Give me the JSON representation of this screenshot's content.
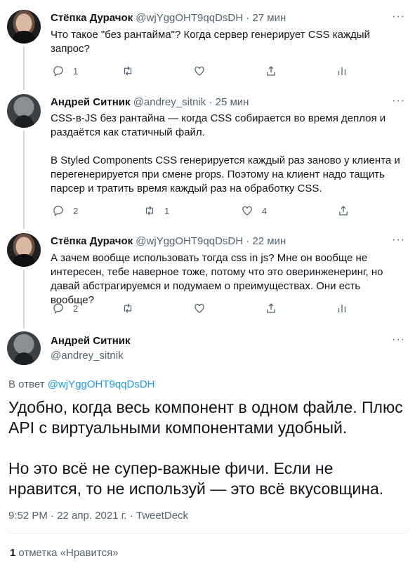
{
  "tweets": [
    {
      "name": "Стёпка Дурачок",
      "meta": "@wjYggOHT9qqDsDH · 27 мин",
      "paragraphs": [
        "Что такое \"без рантайма\"? Когда сервер генерирует CSS каждый запрос?"
      ],
      "reply_count": "1",
      "retweet_count": "",
      "like_count": ""
    },
    {
      "name": "Андрей Ситник",
      "meta": "@andrey_sitnik · 25 мин",
      "paragraphs": [
        "CSS-в-JS без рантайна — когда CSS собирается во время деплоя и раздаётся как статичный файл.",
        "В Styled Components CSS генерируется каждый раз заново у клиента и перегенерируется при смене props. Поэтому на клиент надо тащить парсер и тратить время каждый раз на обработку CSS."
      ],
      "reply_count": "2",
      "retweet_count": "1",
      "like_count": "4"
    },
    {
      "name": "Стёпка Дурачок",
      "meta": "@wjYggOHT9qqDsDH · 22 мин",
      "paragraphs": [
        "А зачем вообще использовать тогда css in js? Мне он вообще не интересен, тебе наверное тоже, потому что это оверинженеринг, но давай абстрагируемся и подумаем о преимуществах. Они есть вообще?"
      ],
      "reply_count": "2",
      "retweet_count": "",
      "like_count": ""
    }
  ],
  "main_tweet": {
    "name": "Андрей Ситник",
    "handle": "@andrey_sitnik",
    "reply_prefix": "В ответ",
    "reply_handle": "@wjYggOHT9qqDsDH",
    "paragraphs": [
      "Удобно, когда весь компонент в одном файле. Плюс API с виртуальными компонентами удобный.",
      "Но это всё не супер-важные фичи. Если не нравится, то не используй — это всё вкусовщина."
    ],
    "timestamp": "9:52 PM · 22 апр. 2021 г. · TweetDeck",
    "likes_count": "1",
    "likes_label": "отметка «Нравится»"
  },
  "more_label": "···",
  "colors": {
    "accent": "#1d9bf0",
    "muted": "#536471",
    "line": "#cfd9de"
  }
}
